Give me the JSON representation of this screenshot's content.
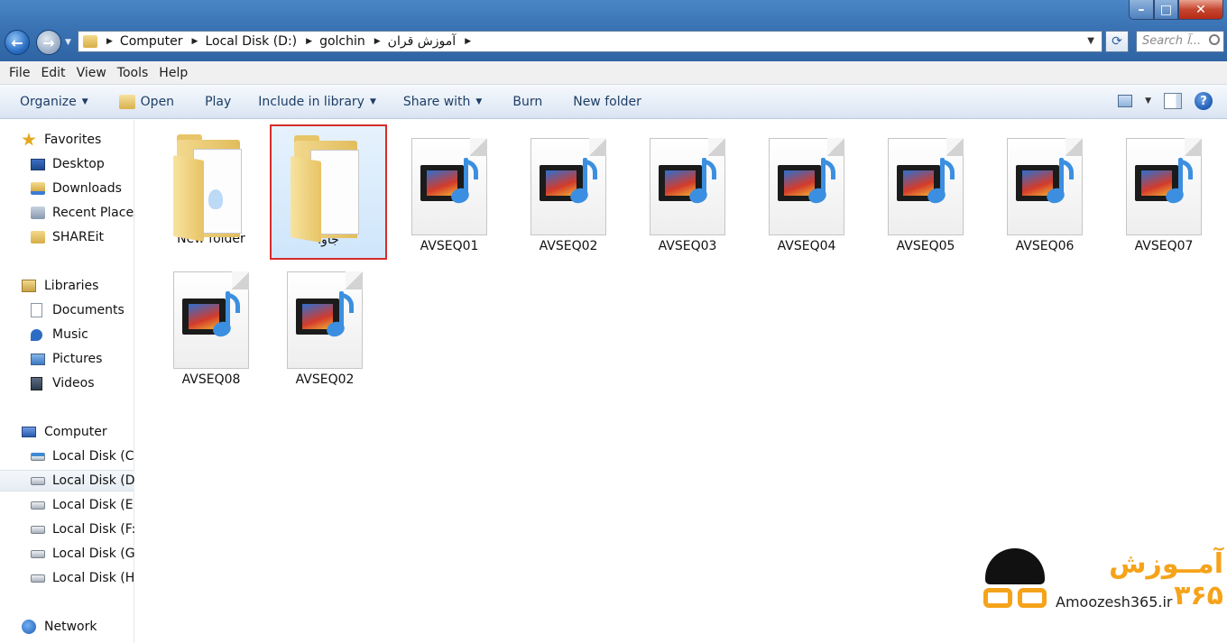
{
  "address": {
    "crumbs": [
      "Computer",
      "Local Disk (D:)",
      "golchin",
      "آموزش قران"
    ],
    "search_placeholder": "Search آ..."
  },
  "menu": [
    "File",
    "Edit",
    "View",
    "Tools",
    "Help"
  ],
  "toolbar": {
    "organize": "Organize",
    "open": "Open",
    "play": "Play",
    "include_in_library": "Include in library",
    "share_with": "Share with",
    "burn": "Burn",
    "new_folder": "New folder"
  },
  "nav": {
    "favorites": {
      "label": "Favorites",
      "items": [
        "Desktop",
        "Downloads",
        "Recent Places",
        "SHAREit"
      ]
    },
    "libraries": {
      "label": "Libraries",
      "items": [
        "Documents",
        "Music",
        "Pictures",
        "Videos"
      ]
    },
    "computer": {
      "label": "Computer",
      "items": [
        "Local Disk (C:)",
        "Local Disk (D:)",
        "Local Disk (E:)",
        "Local Disk (F:)",
        "Local Disk (G:)",
        "Local Disk (H:)"
      ]
    },
    "network": {
      "label": "Network"
    }
  },
  "files": [
    {
      "name": "New folder",
      "type": "folder"
    },
    {
      "name": "جاوا",
      "type": "folder",
      "selected": true
    },
    {
      "name": "AVSEQ01",
      "type": "media"
    },
    {
      "name": "AVSEQ02",
      "type": "media"
    },
    {
      "name": "AVSEQ03",
      "type": "media"
    },
    {
      "name": "AVSEQ04",
      "type": "media"
    },
    {
      "name": "AVSEQ05",
      "type": "media"
    },
    {
      "name": "AVSEQ06",
      "type": "media"
    },
    {
      "name": "AVSEQ07",
      "type": "media"
    },
    {
      "name": "AVSEQ08",
      "type": "media"
    },
    {
      "name": "AVSEQ02",
      "type": "media"
    }
  ],
  "watermark": {
    "title": "آمــوزش ۳۶۵",
    "url": "Amoozesh365.ir"
  },
  "colors": {
    "selection_border": "#d62c2c",
    "accent": "#f5a31a",
    "titlebar": "#3a73b4"
  }
}
